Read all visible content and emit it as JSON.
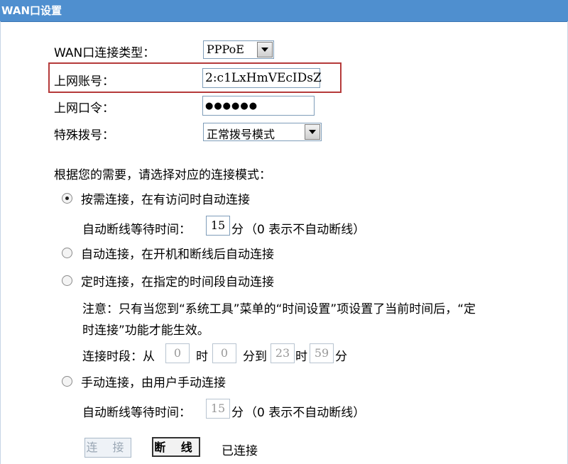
{
  "title": "WAN口设置",
  "wan_type": {
    "label": "WAN口连接类型：",
    "value": "PPPoE"
  },
  "account": {
    "label": "上网账号：",
    "value": "2:c1LxHmVEcIDsZ"
  },
  "password": {
    "label": "上网口令：",
    "value": "●●●●●●"
  },
  "dial": {
    "label": "特殊拨号：",
    "value": "正常拨号模式"
  },
  "mode_prompt": "根据您的需要，请选择对应的连接模式：",
  "modes": [
    {
      "label": "按需连接，在有访问时自动连接",
      "selected": true
    },
    {
      "label": "自动连接，在开机和断线后自动连接",
      "selected": false
    },
    {
      "label": "定时连接，在指定的时间段自动连接",
      "selected": false
    },
    {
      "label": "手动连接，由用户手动连接",
      "selected": false
    }
  ],
  "idle1": {
    "label": "自动断线等待时间：",
    "value": "15",
    "unit": "分",
    "hint": "（0 表示不自动断线）"
  },
  "notice_line1": "注意：只有当您到“系统工具”菜单的“时间设置”项设置了当前时间后，“定",
  "notice_line2": "时连接”功能才能生效。",
  "period": {
    "label": "连接时段：从",
    "from_hour": "0",
    "hour_unit": "时",
    "from_min": "0",
    "min_unit_to": "分到",
    "to_hour": "23",
    "to_hour_unit": "时",
    "to_min": "59",
    "to_min_unit": "分"
  },
  "idle2": {
    "label": "自动断线等待时间：",
    "value": "15",
    "unit": "分",
    "hint": "（0 表示不自动断线）"
  },
  "buttons": {
    "connect": "连 接",
    "disconnect": "断 线"
  },
  "status": "已连接"
}
